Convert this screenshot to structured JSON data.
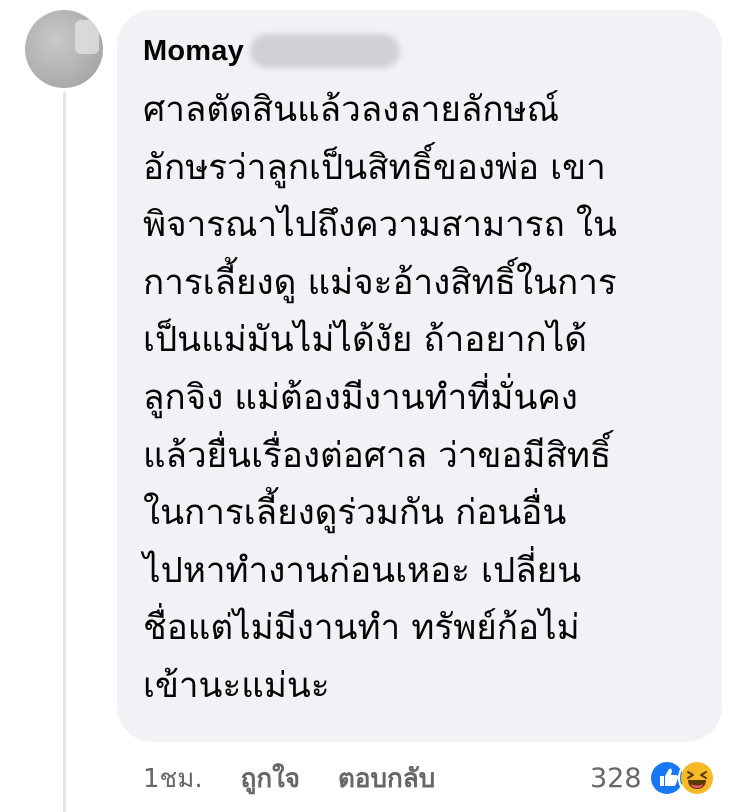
{
  "comment": {
    "author_name": "Momay",
    "lines": [
      "ศาลตัดสินแล้วลงลายลักษณ์",
      "อักษรว่าลูกเป็นสิทธิ์ของพ่อ เขา",
      "พิจารณาไปถึงความสามารถ ใน",
      "การเลี้ยงดู แม่จะอ้างสิทธิ์ในการ",
      "เป็นแม่มันไม่ได้งัย ถ้าอยากได้",
      "ลูกจิง แม่ต้องมีงานทำที่มั่นคง",
      "แล้วยื่นเรื่องต่อศาล ว่าขอมีสิทธิ์",
      "ในการเลี้ยงดูร่วมกัน  ก่อนอื่น",
      "ไปหาทำงานก่อนเหอะ เปลี่ยน",
      "ชื่อแต่ไม่มีงานทำ ทรัพย์ก้อไม่",
      "เข้านะแม่นะ"
    ]
  },
  "actions": {
    "timestamp": "1ชม.",
    "like_label": "ถูกใจ",
    "reply_label": "ตอบกลับ"
  },
  "reactions": {
    "count": "328",
    "icons": [
      "like-icon",
      "haha-icon"
    ]
  },
  "colors": {
    "bubble_bg": "#f0f2f5",
    "text_primary": "#050505",
    "text_secondary": "#65676b",
    "like_blue": "#1877f2",
    "haha_yellow": "#f7b928"
  }
}
